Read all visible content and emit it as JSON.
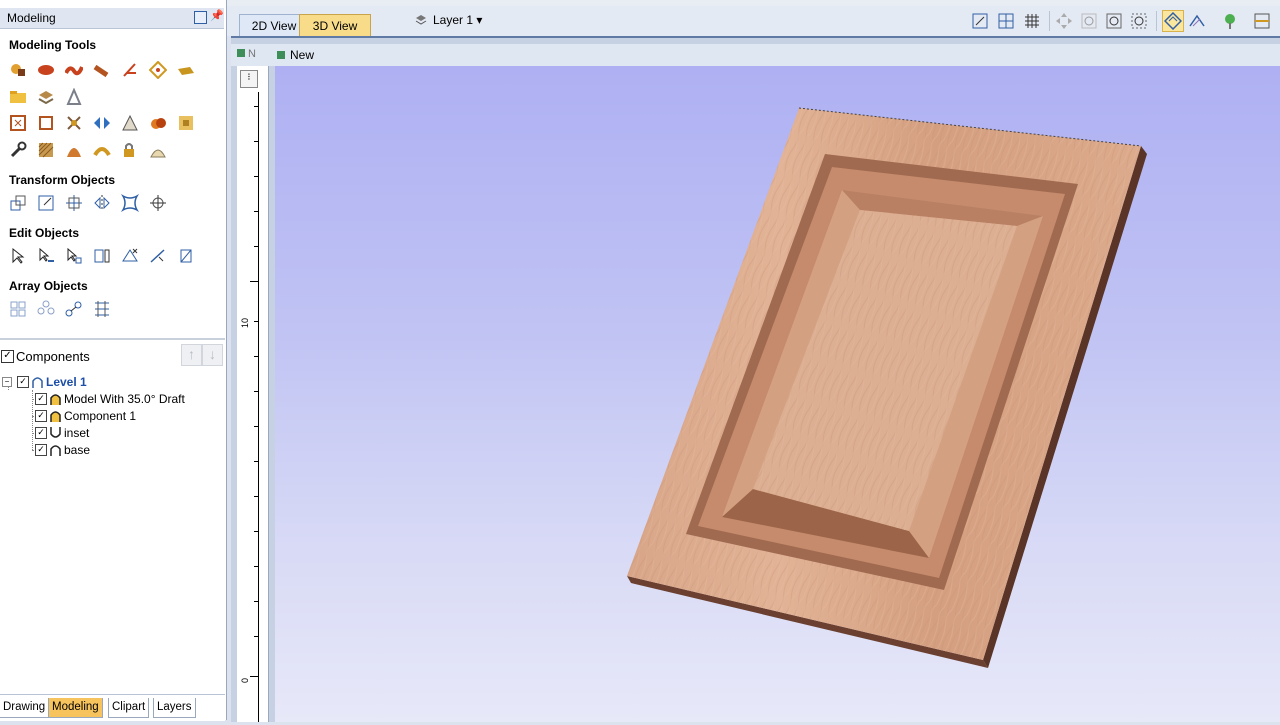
{
  "left_panel": {
    "title": "Modeling",
    "sections": {
      "modeling_tools": "Modeling Tools",
      "transform_objects": "Transform Objects",
      "edit_objects": "Edit Objects",
      "array_objects": "Array Objects"
    },
    "components": {
      "title": "Components",
      "tree": [
        {
          "label": "Level 1",
          "icon": "level-icon",
          "checked": true
        },
        {
          "label": "Model With 35.0° Draft",
          "icon": "component-icon",
          "checked": true
        },
        {
          "label": "Component 1",
          "icon": "component-icon",
          "checked": true
        },
        {
          "label": "inset",
          "icon": "subtract-icon",
          "checked": true
        },
        {
          "label": "base",
          "icon": "component-icon",
          "checked": true
        }
      ]
    },
    "bottom_tabs": [
      "Drawing",
      "Modeling",
      "Clipart",
      "Layers"
    ],
    "active_bottom_tab": "Modeling"
  },
  "toolbar": {
    "tabs": [
      "2D View",
      "3D View"
    ],
    "active_tab": "3D View",
    "layer": "Layer 1 ▾"
  },
  "document": {
    "tab_partial": "N",
    "tab_name": "New"
  },
  "ruler": {
    "labels": [
      "10",
      "0"
    ]
  },
  "colors": {
    "accent_tab": "#f9dc8a",
    "panel_bg": "#ffffff",
    "wood": "#d8a585",
    "scene_top": "#aeb0f3",
    "scene_bottom": "#e7e8f8"
  }
}
